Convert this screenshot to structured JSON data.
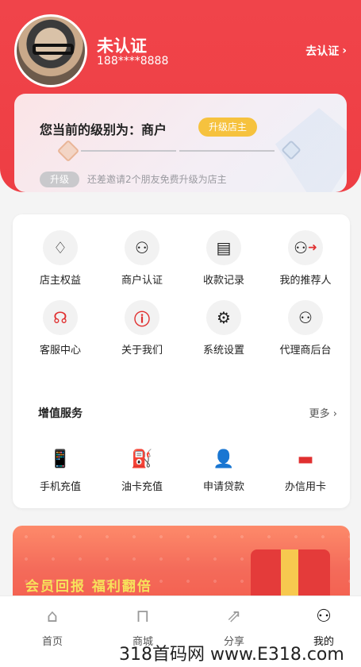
{
  "user": {
    "name": "未认证",
    "phone": "188****8888",
    "auth_link": "去认证"
  },
  "level": {
    "title": "您当前的级别为：商户",
    "upgrade_button": "升级店主",
    "upgrade_tag": "升级",
    "hint": "还差邀请2个朋友免费升级为店主"
  },
  "grid": [
    {
      "label": "店主权益",
      "icon": "diamond-icon"
    },
    {
      "label": "商户认证",
      "icon": "user-cert-icon"
    },
    {
      "label": "收款记录",
      "icon": "receipt-search-icon"
    },
    {
      "label": "我的推荐人",
      "icon": "user-arrow-icon"
    },
    {
      "label": "客服中心",
      "icon": "headset-icon"
    },
    {
      "label": "关于我们",
      "icon": "info-icon"
    },
    {
      "label": "系统设置",
      "icon": "gear-icon"
    },
    {
      "label": "代理商后台",
      "icon": "agent-icon"
    }
  ],
  "services": {
    "title": "增值服务",
    "more": "更多",
    "items": [
      {
        "label": "手机充值",
        "icon": "phone-topup-icon"
      },
      {
        "label": "油卡充值",
        "icon": "fuel-icon"
      },
      {
        "label": "申请贷款",
        "icon": "loan-icon"
      },
      {
        "label": "办信用卡",
        "icon": "credit-card-icon"
      }
    ]
  },
  "promo": {
    "text": "会员回报 福利翻倍"
  },
  "tabbar": [
    {
      "label": "首页",
      "icon": "home-icon"
    },
    {
      "label": "商城",
      "icon": "bag-icon"
    },
    {
      "label": "分享",
      "icon": "share-icon"
    },
    {
      "label": "我的",
      "icon": "profile-icon"
    }
  ],
  "watermark": "318首码网 www.E318.com"
}
